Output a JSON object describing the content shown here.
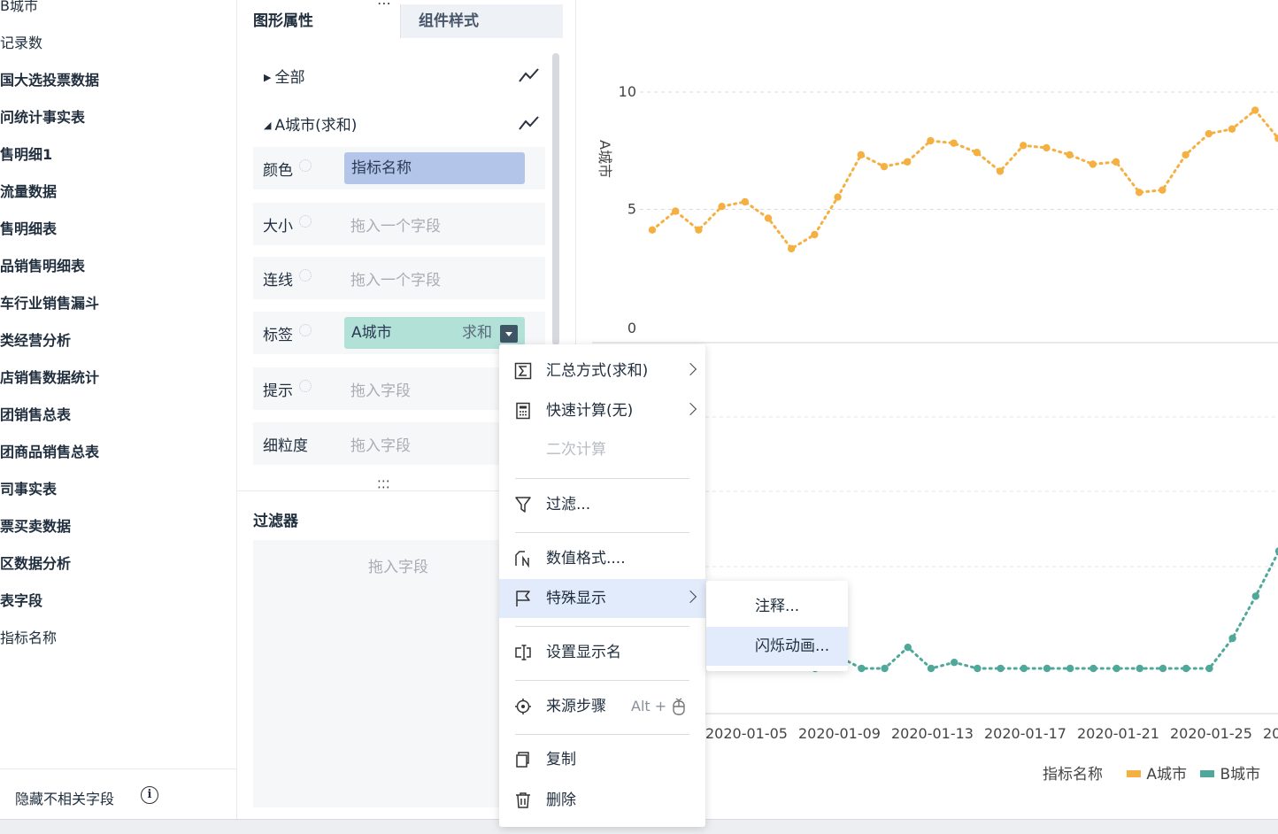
{
  "left_panel": {
    "fields": [
      {
        "label": "B城市",
        "bold": false
      },
      {
        "label": "记录数",
        "bold": false
      },
      {
        "label": "国大选投票数据",
        "bold": true
      },
      {
        "label": "问统计事实表",
        "bold": true
      },
      {
        "label": "售明细1",
        "bold": true
      },
      {
        "label": "流量数据",
        "bold": true
      },
      {
        "label": "售明细表",
        "bold": true
      },
      {
        "label": "品销售明细表",
        "bold": true
      },
      {
        "label": "车行业销售漏斗",
        "bold": true
      },
      {
        "label": "类经营分析",
        "bold": true
      },
      {
        "label": "店销售数据统计",
        "bold": true
      },
      {
        "label": "团销售总表",
        "bold": true
      },
      {
        "label": "团商品销售总表",
        "bold": true
      },
      {
        "label": "司事实表",
        "bold": true
      },
      {
        "label": "票买卖数据",
        "bold": true
      },
      {
        "label": "区数据分析",
        "bold": true
      },
      {
        "label": "表字段",
        "bold": true
      },
      {
        "label": "指标名称",
        "bold": false
      }
    ],
    "hide_unrelated_label": "隐藏不相关字段",
    "info_icon": "i"
  },
  "tabs": {
    "graphic_props": "图形属性",
    "component_style": "组件样式",
    "dots": "⋯"
  },
  "groups": {
    "all": "全部",
    "city_a_sum": "A城市(求和)"
  },
  "props": {
    "color": {
      "label": "颜色",
      "value": "指标名称"
    },
    "size": {
      "label": "大小",
      "placeholder": "拖入一个字段"
    },
    "line": {
      "label": "连线",
      "placeholder": "拖入一个字段"
    },
    "tag": {
      "label": "标签",
      "value": "A城市",
      "agg": "求和"
    },
    "tooltip": {
      "label": "提示",
      "placeholder": "拖入字段"
    },
    "granularity": {
      "label": "细粒度",
      "placeholder": "拖入字段"
    }
  },
  "filter": {
    "title": "过滤器",
    "placeholder": "拖入字段"
  },
  "context_menu": {
    "summary": "汇总方式(求和)",
    "quick_calc": "快速计算(无)",
    "secondary_calc": "二次计算",
    "filter": "过滤...",
    "number_format": "数值格式....",
    "special_display": "特殊显示",
    "set_display_name": "设置显示名",
    "source_step": "来源步骤",
    "source_shortcut": "Alt +",
    "copy": "复制",
    "delete": "删除"
  },
  "submenu": {
    "annotation": "注释...",
    "flash_animation": "闪烁动画..."
  },
  "colors": {
    "series_a": "#f5b042",
    "series_b": "#4fa899",
    "pill_blue": "#b3c6ea",
    "pill_teal": "#b2e1d8",
    "menu_active": "#e2ebfb"
  },
  "chart_data": {
    "type": "line",
    "ylabel": "A城市",
    "ylim_top": [
      0,
      10
    ],
    "yticks_top": [
      "10",
      "5",
      "0"
    ],
    "x_tick_labels": [
      "2020-01-05",
      "2020-01-09",
      "2020-01-13",
      "2020-01-17",
      "2020-01-21",
      "2020-01-25",
      "20"
    ],
    "legend_title": "指标名称",
    "series": [
      {
        "name": "A城市",
        "values": [
          4.2,
          5.0,
          4.2,
          5.2,
          5.4,
          4.7,
          3.4,
          4.0,
          5.6,
          7.4,
          6.9,
          7.1,
          8.0,
          7.9,
          7.5,
          6.7,
          7.8,
          7.7,
          7.4,
          7.0,
          7.1,
          5.8,
          5.9,
          7.4,
          8.3,
          8.5,
          9.3,
          8.1
        ]
      },
      {
        "name": "B城市",
        "visible_values": [
          2.0,
          2.4,
          2.0,
          2.0,
          2.7,
          2.0,
          2.2,
          2.0,
          2.0,
          2.0,
          2.0,
          2.0,
          2.0,
          2.0,
          2.0,
          2.0,
          2.0,
          2.0,
          3.0,
          4.4,
          5.9
        ]
      }
    ]
  }
}
